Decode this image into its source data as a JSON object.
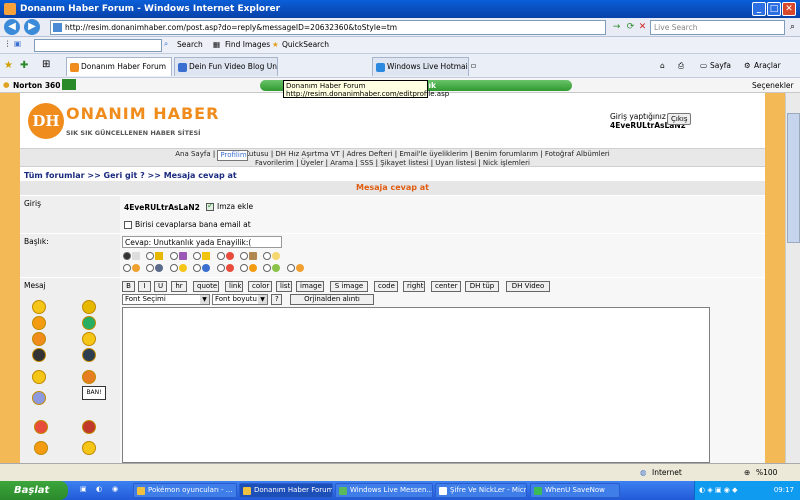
{
  "window": {
    "title": "Donanım Haber Forum - Windows Internet Explorer"
  },
  "address": {
    "url": "http://resim.donanimhaber.com/post.asp?do=reply&messageID=20632360&toStyle=tm",
    "live_search_placeholder": "Live Search"
  },
  "links_bar": {
    "search_label": "Search",
    "find_images": "Find Images",
    "quick_search": "QuickSearch"
  },
  "tabs": [
    {
      "label": "Donanım Haber Forum",
      "active": true
    },
    {
      "label": "Dein Fun Video Blog Unf Unf ...",
      "active": false
    },
    {
      "label": "Windows Live Hotmail",
      "active": false
    }
  ],
  "tab_tools": {
    "page": "Sayfa",
    "tools": "Araçlar"
  },
  "tooltip": {
    "line1": "Donanım Haber Forum",
    "line2": "http://resim.donanimhaber.com/editprofile.asp"
  },
  "norton": {
    "label": "Norton 360",
    "status": "me açık",
    "options": "Seçenekler"
  },
  "site": {
    "logo_text": "ONANIM HABER",
    "logo_letter": "DH",
    "slogan": "SIK SIK GÜNCELLENEN HABER SİTESİ",
    "login_label": "Giriş yaptığınız ad",
    "username": "4EveRULtrAsLaN2",
    "logout": "Çıkış"
  },
  "menu": {
    "row1": [
      "Ana Sayfa",
      "Profilim",
      "Gelen Kutusu",
      "DH Hız Aşırtma VT",
      "Adres Defteri",
      "Email'le üyeliklerim",
      "Benim forumlarım",
      "Fotoğraf Albümleri"
    ],
    "row2": [
      "Favorilerim",
      "Üyeler",
      "Arama",
      "SSS",
      "Şikayet listesi",
      "Uyarı listesi",
      "Nick işlemleri"
    ]
  },
  "breadcrumb": {
    "all_forums": "Tüm forumlar",
    "back": ">> Geri git ?",
    "current": ">> Mesaja cevap at"
  },
  "form": {
    "title": "Mesaja cevap at",
    "login_label": "Giriş",
    "username": "4EveRULtrAsLaN2",
    "signature_label": "Imza ekle",
    "notify_label": "Birisi cevaplarsa bana email at",
    "subject_label": "Başlık:",
    "subject_value": "Cevap: Unutkanlık yada Enayilik:(",
    "message_label": "Mesaj",
    "bbcode": [
      "B",
      "I",
      "U",
      "hr",
      "quote",
      "link",
      "color",
      "list",
      "image",
      "S image",
      "code",
      "right",
      "center",
      "DH tüp",
      "DH Video"
    ],
    "font_select": "Font Seçimi",
    "font_size": "Font boyutu",
    "help": "?",
    "orig_quote": "Orjinalden alıntı",
    "smiley_badge": "BAN!"
  },
  "status": {
    "zone": "Internet",
    "zoom": "%100"
  },
  "taskbar": {
    "start": "Başlat",
    "tasks": [
      "Pokémon oyuncuları - ...",
      "Donanım Haber Forum...",
      "Windows Live Messen...",
      "Şifre Ve NickLer - Micr...",
      "WhenU SaveNow"
    ],
    "clock": "09:17"
  }
}
